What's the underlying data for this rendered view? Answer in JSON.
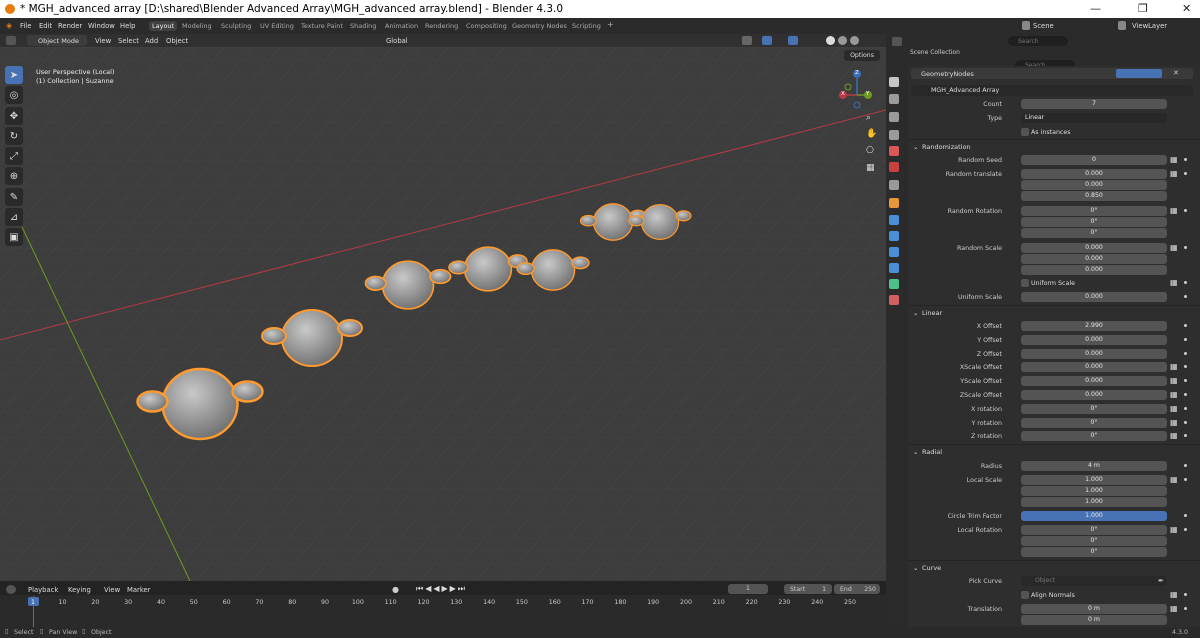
{
  "window": {
    "title": "* MGH_advanced array [D:\\shared\\Blender Advanced Array\\MGH_advanced array.blend] - Blender 4.3.0"
  },
  "menus": [
    "File",
    "Edit",
    "Render",
    "Window",
    "Help"
  ],
  "workspaces": [
    "Layout",
    "Modeling",
    "Sculpting",
    "UV Editing",
    "Texture Paint",
    "Shading",
    "Animation",
    "Rendering",
    "Compositing",
    "Geometry Nodes",
    "Scripting"
  ],
  "workspace_add": "+",
  "scene": {
    "label": "Scene",
    "viewlayer": "ViewLayer"
  },
  "viewport_header": {
    "mode": "Object Mode",
    "items": [
      "View",
      "Select",
      "Add",
      "Object"
    ],
    "transform": "Global",
    "options": "Options"
  },
  "viewport": {
    "perspective": "User Perspective (Local)",
    "collection": "(1) Collection | Suzanne",
    "gizmo": {
      "x": "X",
      "y": "Y",
      "z": "Z"
    }
  },
  "outliner": {
    "search_placeholder": "Search",
    "collection": "Scene Collection"
  },
  "properties": {
    "search_placeholder": "Search",
    "modifier_tab": "GeometryNodes",
    "node_group": "MGH_Advanced Array",
    "top_fields": [
      {
        "label": "Count",
        "value": "7"
      },
      {
        "label": "Type",
        "value": "Linear"
      }
    ],
    "as_instances": "As instances",
    "sections": {
      "randomization": "Randomization",
      "linear": "Linear",
      "radial": "Radial",
      "curve": "Curve"
    },
    "randomization_fields": [
      {
        "label": "Random Seed",
        "values": [
          "0"
        ]
      },
      {
        "label": "Random translate",
        "values": [
          "0.000",
          "0.000",
          "0.850"
        ]
      },
      {
        "label": "Random Rotation",
        "values": [
          "0°",
          "0°",
          "0°"
        ]
      },
      {
        "label": "Random Scale",
        "values": [
          "0.000",
          "0.000",
          "0.000"
        ]
      }
    ],
    "uniform_scale_check": "Uniform Scale",
    "uniform_scale": {
      "label": "Uniform Scale",
      "value": "0.000"
    },
    "linear_fields": [
      {
        "label": "X Offset",
        "value": "2.990"
      },
      {
        "label": "Y Offset",
        "value": "0.000"
      },
      {
        "label": "Z Offset",
        "value": "0.000"
      },
      {
        "label": "XScale Offset",
        "value": "0.000"
      },
      {
        "label": "YScale Offset",
        "value": "0.000"
      },
      {
        "label": "ZScale Offset",
        "value": "0.000"
      },
      {
        "label": "X rotation",
        "value": "0°"
      },
      {
        "label": "Y rotation",
        "value": "0°"
      },
      {
        "label": "Z rotation",
        "value": "0°"
      }
    ],
    "radial_fields": {
      "radius": {
        "label": "Radius",
        "value": "4 m"
      },
      "local_scale": {
        "label": "Local Scale",
        "values": [
          "1.000",
          "1.000",
          "1.000"
        ]
      },
      "trim": {
        "label": "Circle Trim Factor",
        "value": "1.000"
      },
      "local_rotation": {
        "label": "Local Rotation",
        "values": [
          "0°",
          "0°",
          "0°"
        ]
      }
    },
    "curve_fields": {
      "pick_curve": {
        "label": "Pick Curve",
        "placeholder": "Object"
      },
      "align_normals": "Align Normals",
      "translation": {
        "label": "Translation",
        "values": [
          "0 m",
          "0 m"
        ]
      }
    }
  },
  "timeline": {
    "menus": [
      "Playback",
      "Keying",
      "View",
      "Marker"
    ],
    "current_frame": "1",
    "start_label": "Start",
    "start": "1",
    "end_label": "End",
    "end": "250",
    "ticks": [
      "1",
      "10",
      "20",
      "30",
      "40",
      "50",
      "60",
      "70",
      "80",
      "90",
      "100",
      "110",
      "120",
      "130",
      "140",
      "150",
      "160",
      "170",
      "180",
      "190",
      "200",
      "210",
      "220",
      "230",
      "240",
      "250"
    ]
  },
  "statusbar": {
    "items": [
      "Select",
      "Pan View",
      "Object"
    ],
    "version": "4.3.0"
  },
  "colors": {
    "accent": "#4772b3",
    "selection": "#ff9a2e",
    "x_axis": "#b53a46",
    "y_axis": "#8cbf2a"
  }
}
